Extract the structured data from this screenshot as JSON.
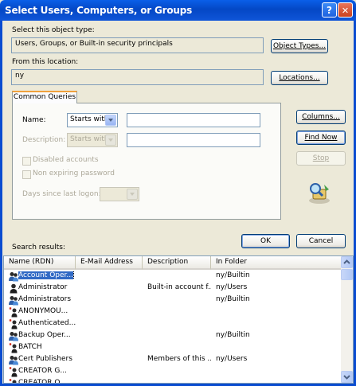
{
  "window": {
    "title": "Select Users, Computers, or Groups",
    "help_label": "?",
    "close_label": "✕"
  },
  "object_type": {
    "label": "Select this object type:",
    "value": "Users, Groups, or Built-in security principals",
    "button": "Object Types..."
  },
  "location": {
    "label": "From this location:",
    "value": "ny",
    "button": "Locations..."
  },
  "tab": {
    "label": "Common Queries"
  },
  "query": {
    "name_label": "Name:",
    "name_op": "Starts with",
    "desc_label": "Description:",
    "desc_op": "Starts with",
    "disabled_label": "Disabled accounts",
    "nonexpiring_label": "Non expiring password",
    "days_label": "Days since last logon:"
  },
  "side_buttons": {
    "columns": "Columns...",
    "find_now": "Find Now",
    "stop": "Stop"
  },
  "search_results_label": "Search results:",
  "ok": "OK",
  "cancel": "Cancel",
  "columns": [
    "Name (RDN)",
    "E-Mail Address",
    "Description",
    "In Folder"
  ],
  "rows": [
    {
      "name": "Account Oper...",
      "email": "",
      "desc": "",
      "folder": "ny/Builtin",
      "icon": "group-icon",
      "selected": true
    },
    {
      "name": "Administrator",
      "email": "",
      "desc": "Built-in account f...",
      "folder": "ny/Users",
      "icon": "user-icon"
    },
    {
      "name": "Administrators",
      "email": "",
      "desc": "",
      "folder": "ny/Builtin",
      "icon": "group-icon"
    },
    {
      "name": "ANONYMOU...",
      "email": "",
      "desc": "",
      "folder": "",
      "icon": "principal-icon"
    },
    {
      "name": "Authenticated...",
      "email": "",
      "desc": "",
      "folder": "",
      "icon": "principal-icon"
    },
    {
      "name": "Backup Oper...",
      "email": "",
      "desc": "",
      "folder": "ny/Builtin",
      "icon": "group-icon"
    },
    {
      "name": "BATCH",
      "email": "",
      "desc": "",
      "folder": "",
      "icon": "principal-icon"
    },
    {
      "name": "Cert Publishers",
      "email": "",
      "desc": "Members of this ...",
      "folder": "ny/Users",
      "icon": "group-icon"
    },
    {
      "name": "CREATOR G...",
      "email": "",
      "desc": "",
      "folder": "",
      "icon": "principal-icon"
    },
    {
      "name": "CREATOR O...",
      "email": "",
      "desc": "",
      "folder": "",
      "icon": "principal-icon"
    }
  ],
  "colors": {
    "title_bar": "#0A5FE8",
    "dialog_bg": "#ECE9D8",
    "selection": "#316AC5",
    "tab_accent": "#F0A13C"
  }
}
